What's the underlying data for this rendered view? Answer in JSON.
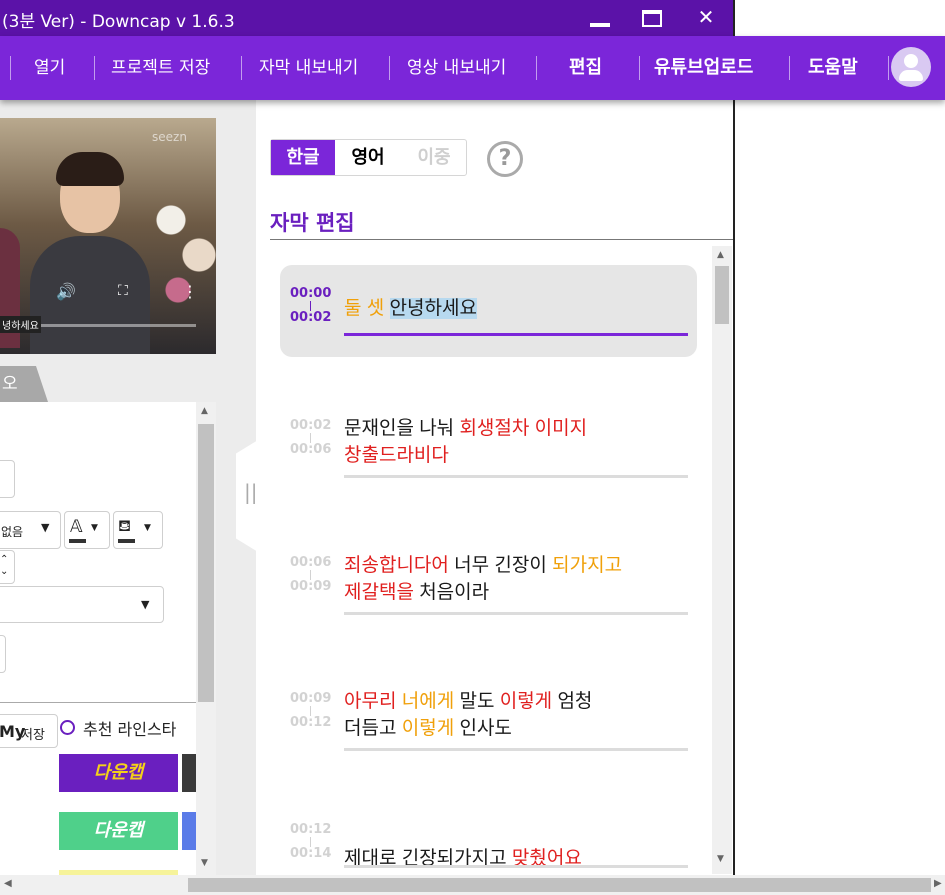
{
  "window": {
    "title": "(3분 Ver) - Downcap v 1.6.3",
    "minimize_icon": "minimize-icon",
    "maximize_icon": "maximize-icon",
    "close_icon": "close-icon"
  },
  "menu": {
    "items": [
      {
        "label": "열기"
      },
      {
        "label": "프로젝트 저장"
      },
      {
        "label": "자막 내보내기"
      },
      {
        "label": "영상 내보내기"
      },
      {
        "label": "편집"
      },
      {
        "label": "유튜브업로드"
      },
      {
        "label": "도움말"
      }
    ],
    "accent": "#7b26d9",
    "title_color": "#5b12a8"
  },
  "video": {
    "logo": "seezn",
    "subtitle_overlay": "녕하세요"
  },
  "left_panel": {
    "tab_label": "오",
    "font_select": "없음",
    "my_save_label": "My",
    "my_save_label2": "저장",
    "recommend_label": "추천 라인스타",
    "style1": "다운캡",
    "style2": "다운캡"
  },
  "editor": {
    "lang_tabs": [
      {
        "label": "한글",
        "active": true
      },
      {
        "label": "영어",
        "active": false
      },
      {
        "label": "이중",
        "active": false
      }
    ],
    "help_glyph": "?",
    "section_title": "자막 편집",
    "subtitles": [
      {
        "start": "00:00",
        "end": "00:02",
        "selected": true,
        "segments": [
          {
            "text": "둘 셋 ",
            "color": "orange"
          },
          {
            "text": "안녕하세요",
            "color": "highlight"
          }
        ]
      },
      {
        "start": "00:02",
        "end": "00:06",
        "selected": false,
        "segments": [
          {
            "text": "문재인을 나눠 ",
            "color": "black"
          },
          {
            "text": "회생절차 이미지",
            "color": "red"
          },
          {
            "text": "\n",
            "color": "black"
          },
          {
            "text": "창출드라비다",
            "color": "red"
          }
        ]
      },
      {
        "start": "00:06",
        "end": "00:09",
        "selected": false,
        "segments": [
          {
            "text": "죄송합니다어",
            "color": "red"
          },
          {
            "text": " 너무 긴장이 ",
            "color": "black"
          },
          {
            "text": "되가지고",
            "color": "orange"
          },
          {
            "text": "\n",
            "color": "black"
          },
          {
            "text": "제갈택을",
            "color": "red"
          },
          {
            "text": " 처음이라",
            "color": "black"
          }
        ]
      },
      {
        "start": "00:09",
        "end": "00:12",
        "selected": false,
        "segments": [
          {
            "text": "아무리",
            "color": "red"
          },
          {
            "text": " ",
            "color": "black"
          },
          {
            "text": "너에게",
            "color": "orange"
          },
          {
            "text": " 말도 ",
            "color": "black"
          },
          {
            "text": "이렇게",
            "color": "red"
          },
          {
            "text": " 엄청",
            "color": "black"
          },
          {
            "text": "\n",
            "color": "black"
          },
          {
            "text": "더듬고 ",
            "color": "black"
          },
          {
            "text": "이렇게",
            "color": "orange"
          },
          {
            "text": " 인사도",
            "color": "black"
          }
        ]
      },
      {
        "start": "00:12",
        "end": "00:14",
        "selected": false,
        "segments": [
          {
            "text": "제대로 긴장되가지고 ",
            "color": "black"
          },
          {
            "text": "맞췄어요",
            "color": "red"
          }
        ]
      }
    ]
  }
}
